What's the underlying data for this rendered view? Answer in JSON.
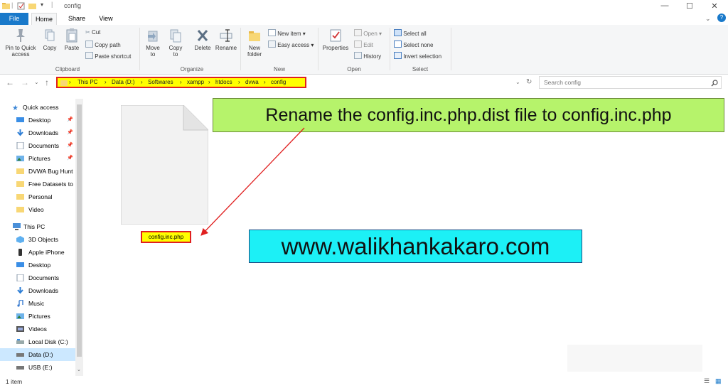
{
  "window": {
    "title": "config",
    "controls": {
      "minimize": "—",
      "maximize": "☐",
      "close": "✕"
    },
    "help": "?"
  },
  "tabs": {
    "file": "File",
    "home": "Home",
    "share": "Share",
    "view": "View"
  },
  "ribbon": {
    "clipboard": {
      "pin_label": "Pin to Quick access",
      "copy_label": "Copy",
      "paste_label": "Paste",
      "cut_label": "Cut",
      "copy_path_label": "Copy path",
      "paste_shortcut_label": "Paste shortcut",
      "group_label": "Clipboard"
    },
    "organize": {
      "move_to_label": "Move to",
      "copy_to_label": "Copy to",
      "delete_label": "Delete",
      "rename_label": "Rename",
      "group_label": "Organize"
    },
    "new": {
      "new_folder_label": "New folder",
      "new_item_label": "New item",
      "easy_access_label": "Easy access",
      "group_label": "New"
    },
    "open": {
      "properties_label": "Properties",
      "open_label": "Open",
      "edit_label": "Edit",
      "history_label": "History",
      "group_label": "Open"
    },
    "select": {
      "select_all_label": "Select all",
      "select_none_label": "Select none",
      "invert_label": "Invert selection",
      "group_label": "Select"
    }
  },
  "address": {
    "breadcrumbs": [
      "This PC",
      "Data (D:)",
      "Softwares",
      "xampp",
      "htdocs",
      "dvwa",
      "config"
    ],
    "search_placeholder": "Search config"
  },
  "navpane": {
    "quick_access": "Quick access",
    "quick_items": [
      "Desktop",
      "Downloads",
      "Documents",
      "Pictures",
      "DVWA Bug Hunt",
      "Free Datasets to",
      "Personal",
      "Video"
    ],
    "this_pc": "This PC",
    "pc_items": [
      "3D Objects",
      "Apple iPhone",
      "Desktop",
      "Documents",
      "Downloads",
      "Music",
      "Pictures",
      "Videos",
      "Local Disk (C:)",
      "Data (D:)",
      "USB (E:)"
    ]
  },
  "content": {
    "file_name": "config.inc.php",
    "callout_rename": "Rename the config.inc.php.dist  file to config.inc.php",
    "callout_site": "www.walikhankakaro.com"
  },
  "status": {
    "item_count": "1 item"
  },
  "colors": {
    "accent": "#1979ca",
    "highlight": "#ffff00",
    "annotation_border": "#e02020",
    "callout_green": "#b6f36b",
    "callout_cyan": "#1cf0f6"
  }
}
